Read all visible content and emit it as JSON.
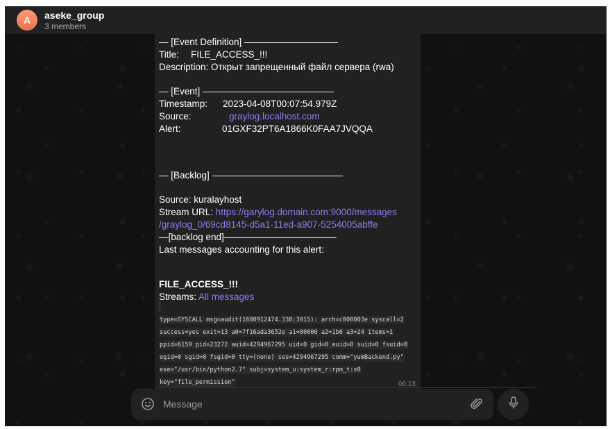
{
  "header": {
    "avatar_letter": "A",
    "chat_title": "aseke_group",
    "subtitle": "3 members"
  },
  "message": {
    "event_def_header": "— [Event Definition] ——————————",
    "title_label": "Title:",
    "title_value": "FILE_ACCESS_!!!",
    "description": "Description: Открыт запрещенный файл сервера (rwa)",
    "event_header": "— [Event] ——————————————",
    "timestamp_label": "Timestamp:",
    "timestamp_value": "2023-04-08T00:07:54.979Z",
    "source_label": "Source:",
    "source_value": "graylog.localhost.com",
    "alert_label": "Alert:",
    "alert_value": "01GXF32PT6A1866K0FAA7JVQQA",
    "backlog_header": "— [Backlog] ——————————————",
    "backlog_source": "Source: kuralayhost",
    "stream_url_label": "Stream URL: ",
    "stream_url_line1": "https://garylog.domain.com:9000/messages",
    "stream_url_line2": "/graylog_0/69cd8145-d5a1-11ed-a907-5254005abffe",
    "backlog_end": "—[backlog end]————————————",
    "last_messages": "Last messages accounting for this alert:",
    "file_access_title": "FILE_ACCESS_!!!",
    "streams_label": "Streams: ",
    "streams_link": "All messages",
    "code_lines": [
      "type=SYSCALL msg=audit(1680912474.338:3015): arch=c000003e syscall=2",
      "success=yes exit=13 a0=7f16ada3652e a1=80000 a2=1b6 a3=24 items=1",
      "ppid=6159 pid=23272 auid=4294967295 uid=0 gid=0 euid=0 suid=0 fsuid=0",
      "egid=0 sgid=0 fsgid=0 tty=(none) ses=4294967295 comm=\"yumBackend.py\"",
      "exe=\"/usr/bin/python2.7\" subj=system_u:system_r:rpm_t:s0",
      "key=\"file_permission\""
    ],
    "time": "06:13"
  },
  "composer": {
    "placeholder": "Message"
  },
  "icons": {
    "emoji": "smile-icon",
    "attach": "paperclip-icon",
    "voice": "microphone-icon"
  },
  "colors": {
    "link": "#8e7cf0",
    "bubble": "#212121",
    "avatar": "#f08a67"
  }
}
